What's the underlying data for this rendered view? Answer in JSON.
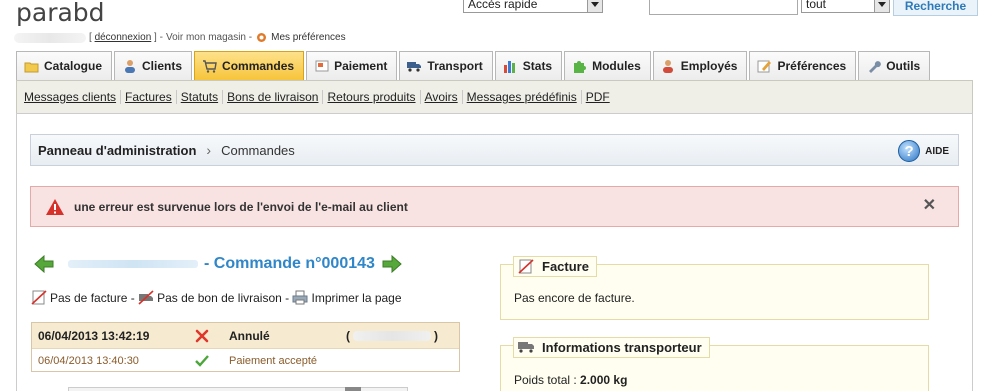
{
  "header": {
    "shop_name": "parabd",
    "logout_label": "déconnexion",
    "view_shop_label": "Voir mon magasin",
    "preferences_label": "Mes préférences"
  },
  "quick_access": {
    "selected": "Accès rapide"
  },
  "search": {
    "value": "",
    "scope": "tout",
    "button_label": "Recherche"
  },
  "tabs": [
    {
      "label": "Catalogue",
      "icon": "folder-icon",
      "active": false
    },
    {
      "label": "Clients",
      "icon": "customer-icon",
      "active": false
    },
    {
      "label": "Commandes",
      "icon": "cart-icon",
      "active": true
    },
    {
      "label": "Paiement",
      "icon": "payment-icon",
      "active": false
    },
    {
      "label": "Transport",
      "icon": "truck-icon",
      "active": false
    },
    {
      "label": "Stats",
      "icon": "chart-icon",
      "active": false
    },
    {
      "label": "Modules",
      "icon": "puzzle-icon",
      "active": false
    },
    {
      "label": "Employés",
      "icon": "employee-icon",
      "active": false
    },
    {
      "label": "Préférences",
      "icon": "preferences-icon",
      "active": false
    },
    {
      "label": "Outils",
      "icon": "wrench-icon",
      "active": false
    }
  ],
  "subnav": [
    "Messages clients",
    "Factures",
    "Statuts",
    "Bons de livraison",
    "Retours produits",
    "Avoirs",
    "Messages prédéfinis",
    "PDF"
  ],
  "breadcrumb": {
    "root": "Panneau d'administration",
    "current": "Commandes",
    "help_label": "AIDE"
  },
  "error": {
    "message": "une erreur est survenue lors de l'envoi de l'e-mail au client"
  },
  "order": {
    "title": "- Commande n°000143",
    "actions": {
      "no_invoice": "Pas de facture",
      "no_delivery_slip": "Pas de bon de livraison",
      "print": "Imprimer la page"
    },
    "history": [
      {
        "date": "06/04/2013 13:42:19",
        "status": "Annulé",
        "icon": "cross-icon"
      },
      {
        "date": "06/04/2013 13:40:30",
        "status": "Paiement accepté",
        "icon": "check-icon"
      }
    ]
  },
  "invoice_box": {
    "title": "Facture",
    "body": "Pas encore de facture."
  },
  "carrier_box": {
    "title": "Informations transporteur",
    "weight_label": "Poids total :",
    "weight_value": "2.000 kg"
  },
  "colors": {
    "active_tab": "#f7c43a",
    "link_blue": "#2f86c8",
    "error_bg": "#f8e2e2",
    "fieldset_bg": "#fffef0"
  }
}
